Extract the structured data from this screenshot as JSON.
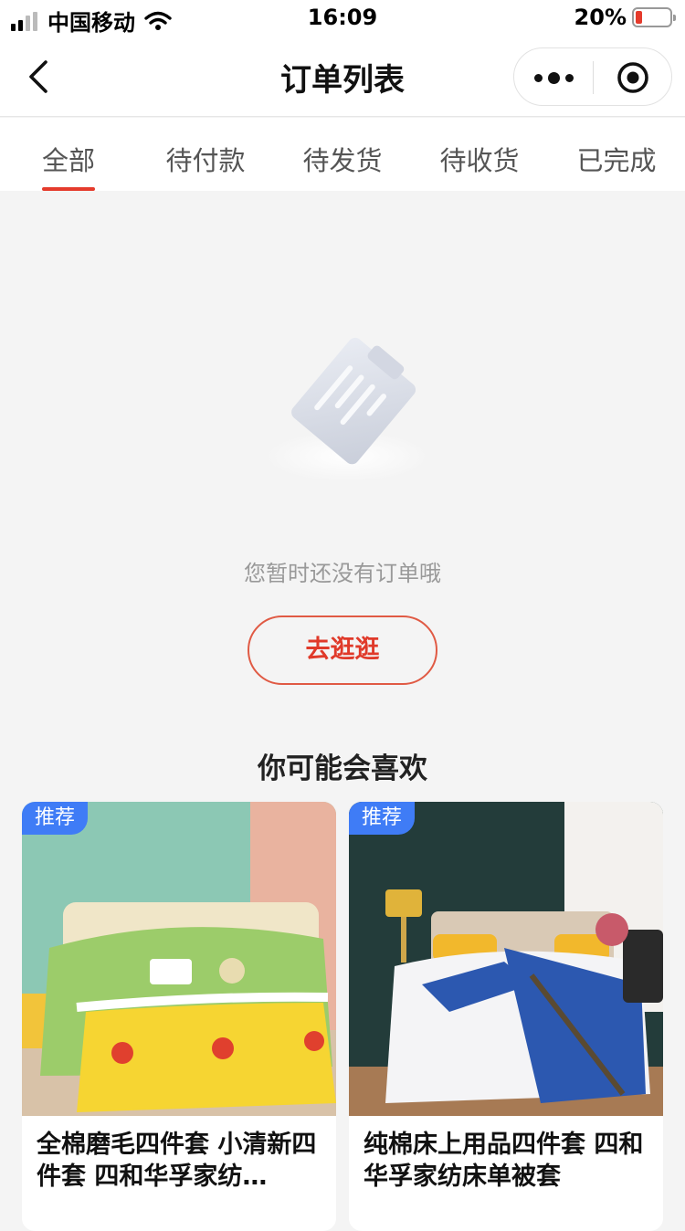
{
  "status_bar": {
    "carrier": "中国移动",
    "time": "16:09",
    "battery_percent": "20%",
    "battery_level": 0.2
  },
  "navbar": {
    "title": "订单列表",
    "back_icon": "chevron-left-icon",
    "more_icon": "more-dots-icon",
    "close_icon": "target-circle-icon"
  },
  "tabs": [
    {
      "label": "全部",
      "active": true
    },
    {
      "label": "待付款",
      "active": false
    },
    {
      "label": "待发货",
      "active": false
    },
    {
      "label": "待收货",
      "active": false
    },
    {
      "label": "已完成",
      "active": false
    }
  ],
  "empty_state": {
    "icon": "empty-order-clipboard-icon",
    "message": "您暂时还没有订单哦",
    "button_label": "去逛逛"
  },
  "recommend": {
    "title": "你可能会喜欢",
    "items": [
      {
        "badge": "推荐",
        "name": "全棉磨毛四件套 小清新四件套 四和华孚家纺…"
      },
      {
        "badge": "推荐",
        "name": "纯棉床上用品四件套 四和华孚家纺床单被套"
      }
    ]
  },
  "colors": {
    "accent": "#e53b2c",
    "badge": "#3f7cf6"
  }
}
